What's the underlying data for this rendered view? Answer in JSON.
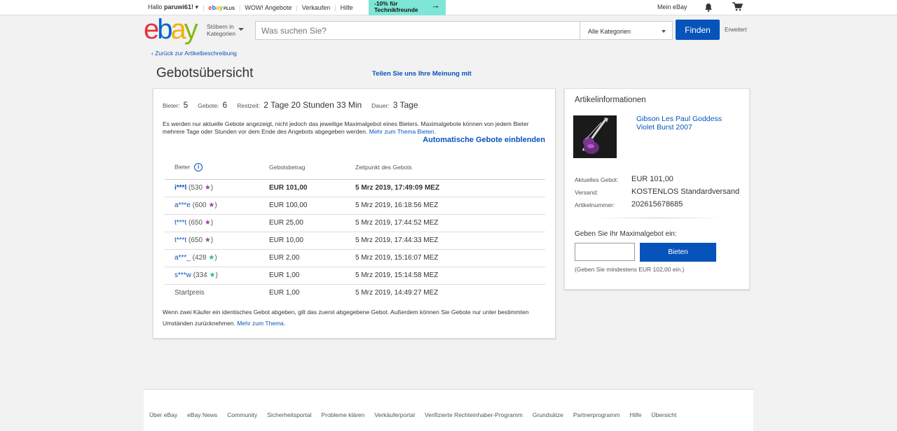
{
  "topbar": {
    "greeting": "Hallo",
    "username": "paruwi61!",
    "ebay_plus": {
      "e": "e",
      "b": "b",
      "a": "a",
      "y": "y",
      "plus": "PLUS"
    },
    "links": [
      "WOW! Angebote",
      "Verkaufen",
      "Hilfe"
    ],
    "promo_line1": "-10% für",
    "promo_line2": "Technikfreunde",
    "promo_arrow": "→",
    "my_ebay": "Mein eBay",
    "icons": [
      "bell-icon",
      "cart-icon"
    ]
  },
  "header": {
    "logo": {
      "e": "e",
      "b": "b",
      "a": "a",
      "y": "y"
    },
    "shop_by_1": "Stöbern in",
    "shop_by_2": "Kategorien",
    "search_placeholder": "Was suchen Sie?",
    "category": "Alle Kategorien",
    "find_button": "Finden",
    "advanced": "Erweitert"
  },
  "nav": {
    "back_link": "Zurück zur Artikelbeschreibung",
    "back_icon": "‹"
  },
  "page": {
    "title": "Gebotsübersicht",
    "feedback": "Teilen Sie uns Ihre Meinung mit"
  },
  "summary": {
    "bidders_label": "Bieter:",
    "bidders_value": "5",
    "bids_label": "Gebote:",
    "bids_value": "6",
    "time_left_label": "Restzeit:",
    "time_left_value": "2 Tage 20 Stunden 33 Min",
    "duration_label": "Dauer:",
    "duration_value": "3 Tage",
    "intro_text": "Es werden nur aktuelle Gebote angezeigt, nicht jedoch das jeweilige Maximalgebot eines Bieters. Maximalgebote können von jedem Bieter mehrere Tage oder Stunden vor dem Ende des Angebots abgegeben werden.",
    "intro_link": "Mehr zum Thema Bieten.",
    "auto_bids": "Automatische Gebote einblenden"
  },
  "bids_table": {
    "headers": {
      "bidder": "Bieter",
      "amount": "Gebotsbetrag",
      "time": "Zeitpunkt des Gebots"
    },
    "info_icon": "i",
    "rows": [
      {
        "bidder": "i***l",
        "score": "530",
        "star": "★",
        "star_color": "#9b3fa8",
        "amount": "EUR 101,00",
        "time": "5 Mrz 2019, 17:49:09 MEZ"
      },
      {
        "bidder": "a***e",
        "score": "600",
        "star": "★",
        "star_color": "#9b3fa8",
        "amount": "EUR 100,00",
        "time": "5 Mrz 2019, 16:18:56 MEZ"
      },
      {
        "bidder": "t***t",
        "score": "650",
        "star": "★",
        "star_color": "#9b3fa8",
        "amount": "EUR 25,00",
        "time": "5 Mrz 2019, 17:44:52 MEZ"
      },
      {
        "bidder": "t***t",
        "score": "650",
        "star": "★",
        "star_color": "#9b3fa8",
        "amount": "EUR 10,00",
        "time": "5 Mrz 2019, 17:44:33 MEZ"
      },
      {
        "bidder": "a***_",
        "score": "428",
        "star": "★",
        "star_color": "#2bb5a6",
        "amount": "EUR 2,00",
        "time": "5 Mrz 2019, 15:16:07 MEZ"
      },
      {
        "bidder": "s***w",
        "score": "334",
        "star": "★",
        "star_color": "#2bb5a6",
        "amount": "EUR 1,00",
        "time": "5 Mrz 2019, 15:14:58 MEZ"
      }
    ],
    "start": {
      "label": "Startpreis",
      "amount": "EUR 1,00",
      "time": "5 Mrz 2019, 14:49:27 MEZ"
    }
  },
  "footnote": {
    "text": "Wenn zwei Käufer ein identisches Gebot abgeben, gilt das zuerst abgegebene Gebot. Außerdem können Sie Gebote nur unter bestimmten Umständen zurücknehmen.",
    "link": "Mehr zum Thema."
  },
  "item_info": {
    "title": "Artikelinformationen",
    "item_title_1": "Gibson Les Paul Goddess",
    "item_title_2": "Violet Burst 2007",
    "current_bid_label": "Aktuelles Gebot:",
    "current_bid_value": "EUR 101,00",
    "shipping_label": "Versand:",
    "shipping_value": "KOSTENLOS Standardversand",
    "item_number_label": "Artikelnummer:",
    "item_number_value": "202615678685",
    "max_bid_label": "Geben Sie Ihr Maximalgebot ein:",
    "bid_button": "Bieten",
    "min_note": "(Geben Sie mindestens EUR 102,00 ein.)"
  },
  "footer": {
    "links": [
      "Über eBay",
      "eBay News",
      "Community",
      "Sicherheitsportal",
      "Probleme klären",
      "Verkäuferportal",
      "Verifizierte Rechteinhaber-Programm",
      "Grundsätze",
      "Partnerprogramm",
      "Hilfe",
      "Übersicht"
    ]
  },
  "colors": {
    "accent": "#0654ba",
    "purple_star": "#9b3fa8",
    "teal_star": "#2bb5a6",
    "promo": "#7ee6d6"
  }
}
